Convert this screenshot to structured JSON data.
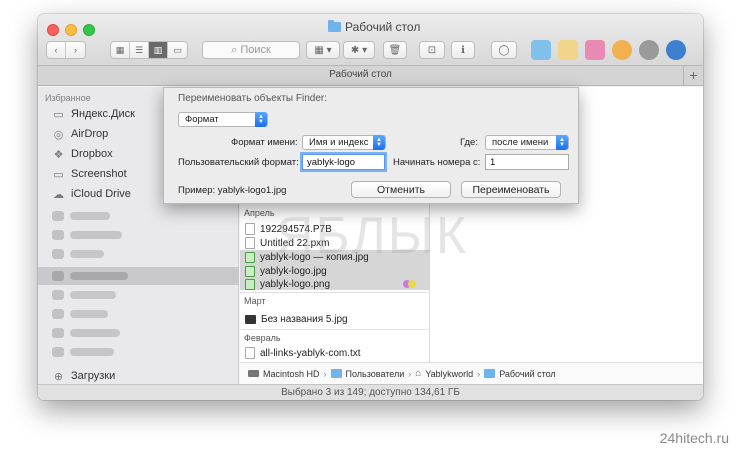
{
  "window": {
    "title": "Рабочий стол",
    "tab_title": "Рабочий стол",
    "tab_add": "+"
  },
  "toolbar": {
    "back": "‹",
    "forward": "›",
    "search_placeholder": "Поиск",
    "search_icon": "magnifier-icon"
  },
  "sidebar": {
    "header": "Избранное",
    "items": [
      {
        "label": "Яндекс.Диск",
        "icon": "folder-icon"
      },
      {
        "label": "AirDrop",
        "icon": "airdrop-icon"
      },
      {
        "label": "Dropbox",
        "icon": "dropbox-icon"
      },
      {
        "label": "Screenshot",
        "icon": "folder-icon"
      },
      {
        "label": "iCloud Drive",
        "icon": "cloud-icon"
      }
    ],
    "downloads": "Загрузки"
  },
  "files": {
    "groups": [
      {
        "name": "Апрель",
        "files": [
          {
            "name": "192294574.P7B",
            "selected": false,
            "icon": "document-icon"
          },
          {
            "name": "Untitled 22.pxm",
            "selected": false,
            "icon": "document-icon"
          },
          {
            "name": "yablyk-logo — копия.jpg",
            "selected": true,
            "icon": "image-icon"
          },
          {
            "name": "yablyk-logo.jpg",
            "selected": true,
            "icon": "image-icon"
          },
          {
            "name": "yablyk-logo.png",
            "selected": true,
            "icon": "image-icon"
          }
        ]
      },
      {
        "name": "Март",
        "files": [
          {
            "name": "Без названия 5.jpg",
            "selected": false,
            "icon": "image-icon"
          }
        ]
      },
      {
        "name": "Февраль",
        "files": [
          {
            "name": "all-links-yablyk-com.txt",
            "selected": false,
            "icon": "document-icon"
          }
        ]
      }
    ]
  },
  "pathbar": {
    "items": [
      "Macintosh HD",
      "Пользователи",
      "Yablykworld",
      "Рабочий стол"
    ]
  },
  "status": "Выбрано 3 из 149; доступно 134,61 ГБ",
  "dialog": {
    "title": "Переименовать объекты Finder:",
    "mode_value": "Формат",
    "name_format_label": "Формат имени:",
    "name_format_value": "Имя и индекс",
    "where_label": "Где:",
    "where_value": "после имени",
    "custom_format_label": "Пользовательский формат:",
    "custom_format_value": "yablyk-logo",
    "start_number_label": "Начинать номера с:",
    "start_number_value": "1",
    "example": "Пример: yablyk-logo1.jpg",
    "cancel": "Отменить",
    "rename": "Переименовать"
  },
  "watermark": "ЯБЛЫК",
  "credit": "24hitech.ru"
}
